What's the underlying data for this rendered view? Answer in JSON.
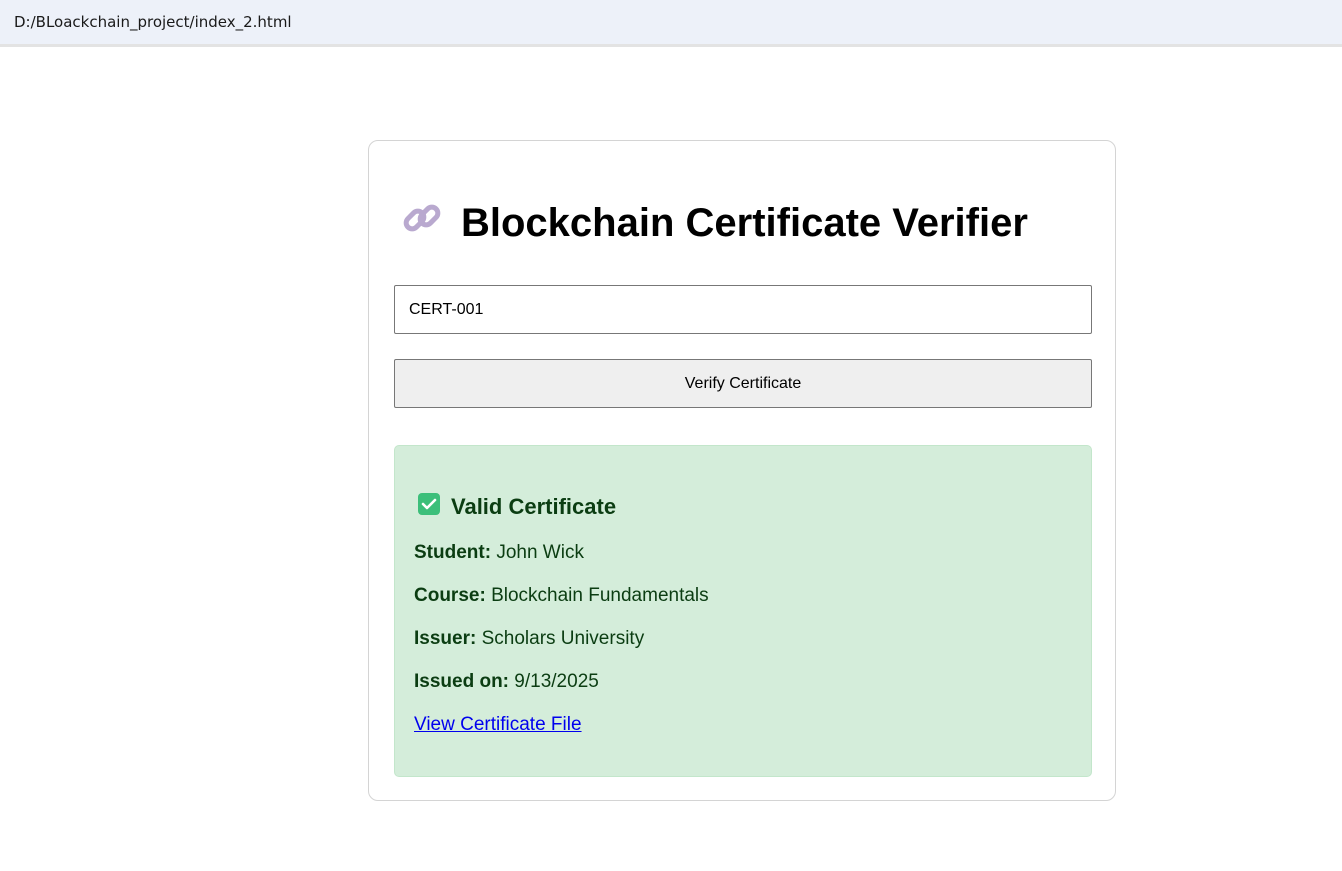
{
  "browser": {
    "address": "D:/BLoackchain_project/index_2.html"
  },
  "app": {
    "title": "Blockchain Certificate Verifier",
    "title_icon": "link-icon"
  },
  "form": {
    "certificate_id_value": "CERT-001",
    "verify_label": "Verify Certificate"
  },
  "result": {
    "status_icon": "check-box-icon",
    "status": "Valid Certificate",
    "student_label": "Student:",
    "student": "John Wick",
    "course_label": "Course:",
    "course": "Blockchain Fundamentals",
    "issuer_label": "Issuer:",
    "issuer": "Scholars University",
    "issued_label": "Issued on:",
    "issued": "9/13/2025",
    "link_label": "View Certificate File"
  }
}
